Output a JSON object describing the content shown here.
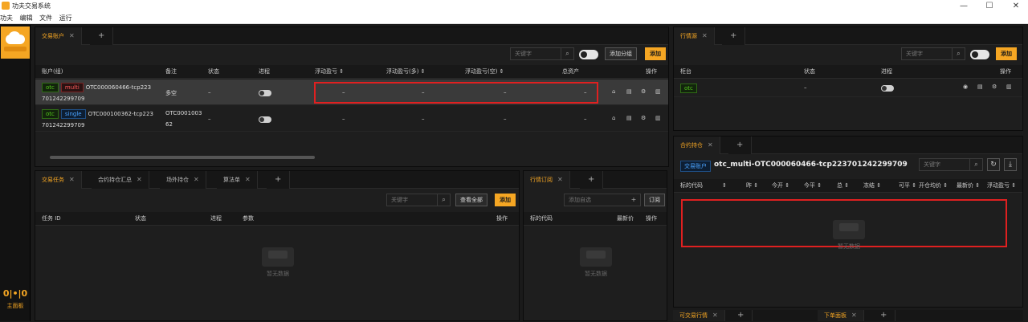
{
  "window": {
    "title": "功夫交易系统",
    "minimize": "—",
    "maximize": "☐",
    "close": "✕"
  },
  "menu": [
    "功夫",
    "编辑",
    "文件",
    "运行"
  ],
  "sidebar": {
    "main_label": "主面板",
    "main_icon": "0|•|0"
  },
  "accounts": {
    "tab": "交易账户",
    "search_placeholder": "关键字",
    "add_group": "添加分组",
    "add": "添加",
    "columns": [
      "账户(组)",
      "备注",
      "状态",
      "进程",
      "浮动盈亏 ⇕",
      "浮动盈亏(多) ⇕",
      "浮动盈亏(空) ⇕",
      "总资产",
      "操作"
    ],
    "rows": [
      {
        "tags": [
          "otc",
          "multi"
        ],
        "name": "OTC000060466-tcp223",
        "name2": "701242299709",
        "note": "多空",
        "status": "–",
        "pnl": "–",
        "pnl_long": "–",
        "pnl_short": "–",
        "assets": "–"
      },
      {
        "tags": [
          "otc",
          "single"
        ],
        "name": "OTC000100362-tcp223",
        "name2": "701242299709",
        "note": "OTC0001003",
        "note2": "62",
        "status": "–",
        "pnl": "–",
        "pnl_long": "–",
        "pnl_short": "–",
        "assets": "–"
      }
    ]
  },
  "tasks": {
    "tabs": [
      "交易任务",
      "合约持仓汇总",
      "场外持仓",
      "算法单"
    ],
    "search_placeholder": "关键字",
    "view_all": "查看全部",
    "add": "添加",
    "columns": [
      "任务 ID",
      "状态",
      "进程",
      "参数",
      "操作"
    ],
    "empty": "暂无数据"
  },
  "quote_sub": {
    "tab": "行情订阅",
    "add_placeholder": "添加自选",
    "subscribe": "订阅",
    "columns": [
      "标的代码",
      "最新价",
      "操作"
    ],
    "empty": "暂无数据"
  },
  "market_source": {
    "tab": "行情源",
    "search_placeholder": "关键字",
    "add": "添加",
    "columns": [
      "柜台",
      "状态",
      "进程",
      "操作"
    ],
    "rows": [
      {
        "tag": "otc",
        "status": "–"
      }
    ]
  },
  "positions": {
    "tab": "合约持仓",
    "account_badge": "交易账户",
    "account_name": "otc_multi-OTC000060466-tcp223701242299709",
    "search_placeholder": "关键字",
    "columns": [
      "标的代码",
      "⇕",
      "昨 ⇕",
      "今开 ⇕",
      "今平 ⇕",
      "总 ⇕",
      "冻结 ⇕",
      "可平 ⇕",
      "开仓均价 ⇕",
      "最新价 ⇕",
      "浮动盈亏 ⇕"
    ],
    "empty": "暂无数据"
  },
  "bottom_tabs": [
    "可交易行情",
    "下单面板"
  ]
}
